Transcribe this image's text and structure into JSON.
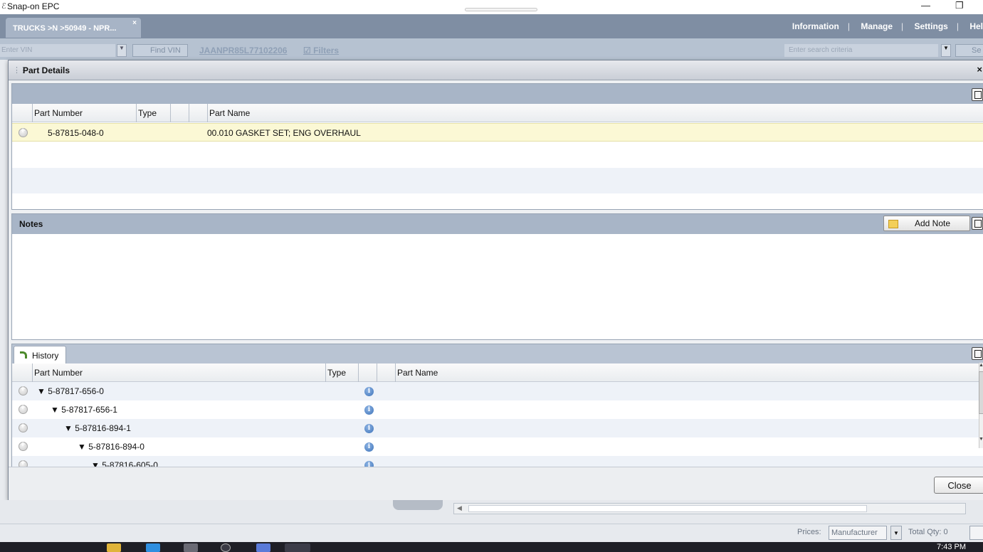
{
  "window": {
    "title": "Snap-on EPC",
    "minimize": "—",
    "restore": "❐"
  },
  "app_bar": {
    "tab_label": "TRUCKS >N >50949 - NPR...",
    "tab_close": "×",
    "links": [
      "Information",
      "Manage",
      "Settings",
      "Hel"
    ]
  },
  "vin_bar": {
    "vin_placeholder": "Enter VIN",
    "find_vin": "Find VIN",
    "vin_code": "JAANPR85L77102206",
    "filters": "Filters",
    "search_placeholder": "Enter search criteria",
    "search_btn": "Se"
  },
  "dialog": {
    "title": "Part Details",
    "close_x": "×",
    "parts": {
      "columns": [
        "Part Number",
        "Type",
        "",
        "Part Name"
      ],
      "rows": [
        {
          "part_number": "5-87815-048-0",
          "type": "",
          "part_name": "00.010 GASKET SET; ENG OVERHAUL"
        }
      ]
    },
    "notes": {
      "title": "Notes",
      "add_note": "Add Note"
    },
    "history": {
      "tab": "History",
      "columns": [
        "Part Number",
        "Type",
        "",
        "Part Name"
      ],
      "rows": [
        {
          "part_number": "5-87817-656-0",
          "indent": 0
        },
        {
          "part_number": "5-87817-656-1",
          "indent": 1
        },
        {
          "part_number": "5-87816-894-1",
          "indent": 2
        },
        {
          "part_number": "5-87816-894-0",
          "indent": 3
        },
        {
          "part_number": "5-87816-605-0",
          "indent": 4
        }
      ]
    },
    "close_button": "Close"
  },
  "status_bar": {
    "prices_label": "Prices:",
    "prices_value": "Manufacturer",
    "total_qty": "Total Qty: 0"
  },
  "taskbar": {
    "clock": "7:43 PM"
  },
  "colors": {
    "header_blue": "#7f8ea3",
    "panel_head": "#a8b5c7",
    "selected_row": "#fbf8d5",
    "info_blue": "#3c72b8"
  }
}
